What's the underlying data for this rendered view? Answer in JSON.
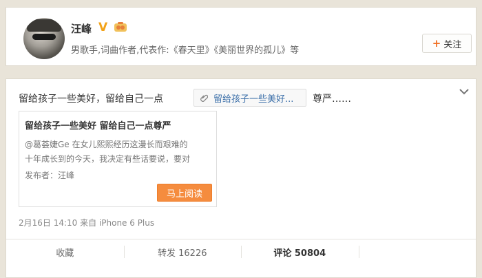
{
  "profile": {
    "name": "汪峰",
    "verified_badge": "V",
    "description": "男歌手,词曲作者,代表作:《春天里》《美丽世界的孤儿》等",
    "follow_label": "关注",
    "follow_icon": "+"
  },
  "post": {
    "text_before": "留给孩子一些美好，留给自己一点",
    "link_label": "留给孩子一些美好...",
    "text_after": "尊严……",
    "article": {
      "title": "留给孩子一些美好 留给自己一点尊严",
      "summary_line1": "@葛荟婕Ge 在女儿熙熙经历这漫长而艰难的",
      "summary_line2": "十年成长到的今天，我决定有些话要说，要对",
      "publisher": "发布者：汪峰",
      "read_button": "马上阅读"
    },
    "meta": "2月16日 14:10 来自 iPhone 6 Plus"
  },
  "actions": {
    "favorite": "收藏",
    "repost": "转发 16226",
    "comment": "评论 50804",
    "like": ""
  },
  "colors": {
    "accent_orange": "#f58c3e",
    "link_blue": "#3a6ea8",
    "verified_gold": "#f2a218"
  },
  "icons": {
    "follow": "plus-icon",
    "chevron": "chevron-down-icon",
    "link": "link-clip-icon"
  }
}
